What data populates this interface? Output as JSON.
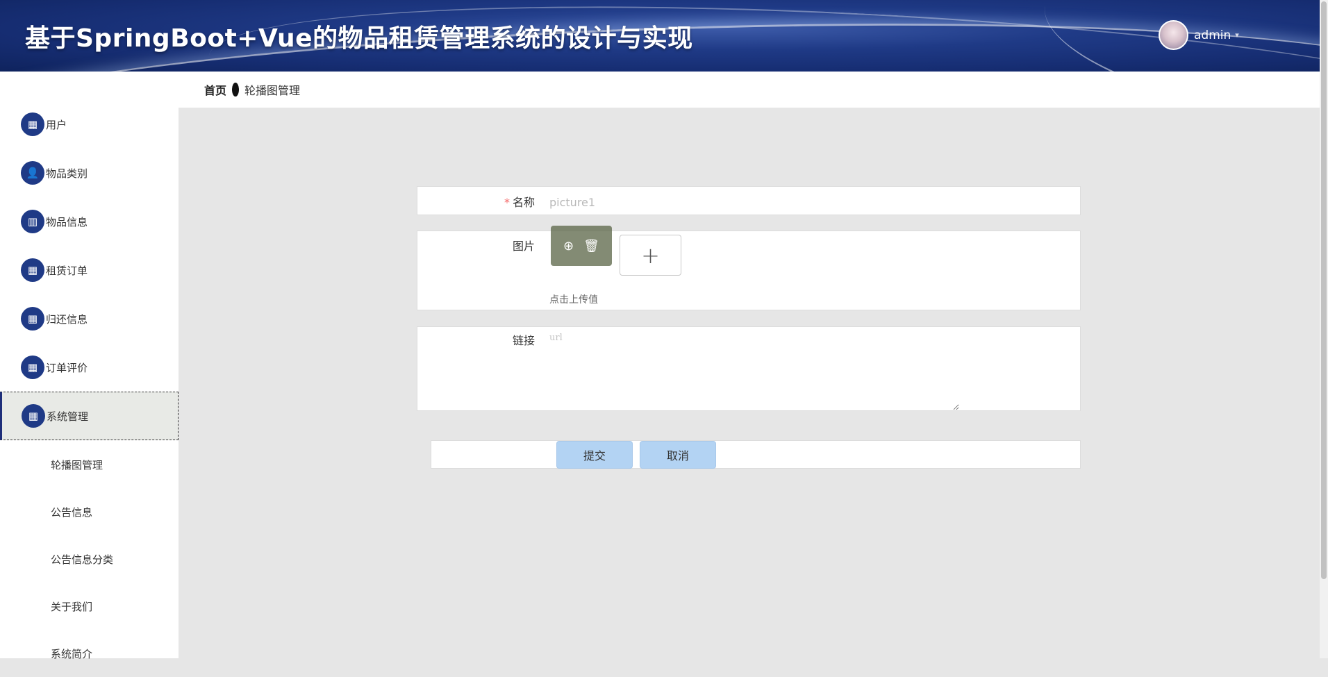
{
  "header": {
    "title": "基于SpringBoot+Vue的物品租赁管理系统的设计与实现",
    "username": "admin",
    "caret": "▾"
  },
  "sidebar": {
    "items": [
      {
        "label": "用户",
        "icon": "grid-icon",
        "glyph": "▦"
      },
      {
        "label": "物品类别",
        "icon": "person-icon",
        "glyph": "👤"
      },
      {
        "label": "物品信息",
        "icon": "book-icon",
        "glyph": "▥"
      },
      {
        "label": "租赁订单",
        "icon": "grid-icon",
        "glyph": "▦"
      },
      {
        "label": "归还信息",
        "icon": "grid-icon",
        "glyph": "▦"
      },
      {
        "label": "订单评价",
        "icon": "grid-icon",
        "glyph": "▦"
      },
      {
        "label": "系统管理",
        "icon": "grid-icon",
        "glyph": "▦"
      }
    ],
    "sub_items": [
      {
        "label": "轮播图管理"
      },
      {
        "label": "公告信息"
      },
      {
        "label": "公告信息分类"
      },
      {
        "label": "关于我们"
      },
      {
        "label": "系统简介"
      }
    ]
  },
  "breadcrumb": {
    "home": "首页",
    "current": "轮播图管理"
  },
  "form": {
    "name_label": "名称",
    "name_required_mark": "*",
    "name_value": "picture1",
    "image_label": "图片",
    "upload_hint": "点击上传值",
    "zoom_glyph": "⊕",
    "delete_glyph": "🗑",
    "plus_glyph": "+",
    "link_label": "链接",
    "link_placeholder": "url",
    "submit_label": "提交",
    "cancel_label": "取消"
  },
  "colors": {
    "header_bg": "#1f3a86",
    "menu_icon_bg": "#1f3a86",
    "button_bg": "#b3d3f3",
    "required": "#f56c6c"
  }
}
